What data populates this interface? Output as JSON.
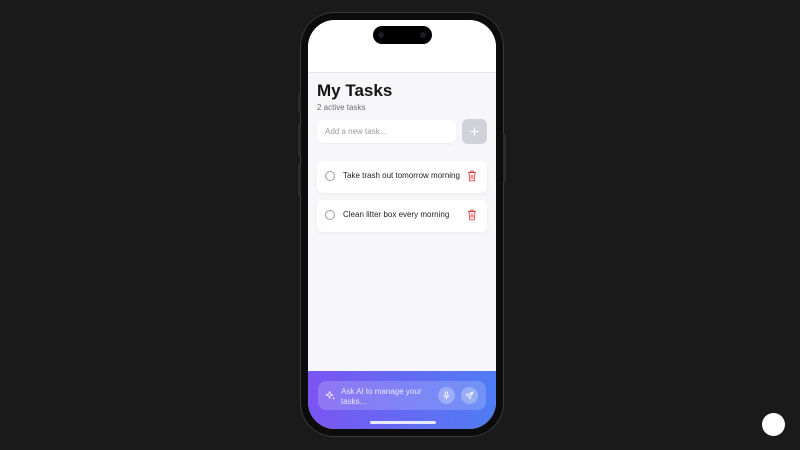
{
  "header": {
    "title": "My Tasks",
    "subtitle": "2 active tasks"
  },
  "new_task": {
    "placeholder": "Add a new task...",
    "add_icon": "plus-icon"
  },
  "tasks": [
    {
      "text": "Take trash out tomorrow morning",
      "completed": false
    },
    {
      "text": "Clean litter box every morning",
      "completed": false
    }
  ],
  "ai_assistant": {
    "placeholder": "Ask AI to manage your tasks...",
    "icons": [
      "sparkle-icon",
      "microphone-icon",
      "send-icon"
    ]
  },
  "colors": {
    "page_background": "#1a1a1a",
    "app_background": "#f7f7f9",
    "delete_icon": "#e04444",
    "ai_gradient_start": "#7a55f2",
    "ai_gradient_end": "#4f7df5",
    "add_button_disabled": "#d1d2d8"
  }
}
